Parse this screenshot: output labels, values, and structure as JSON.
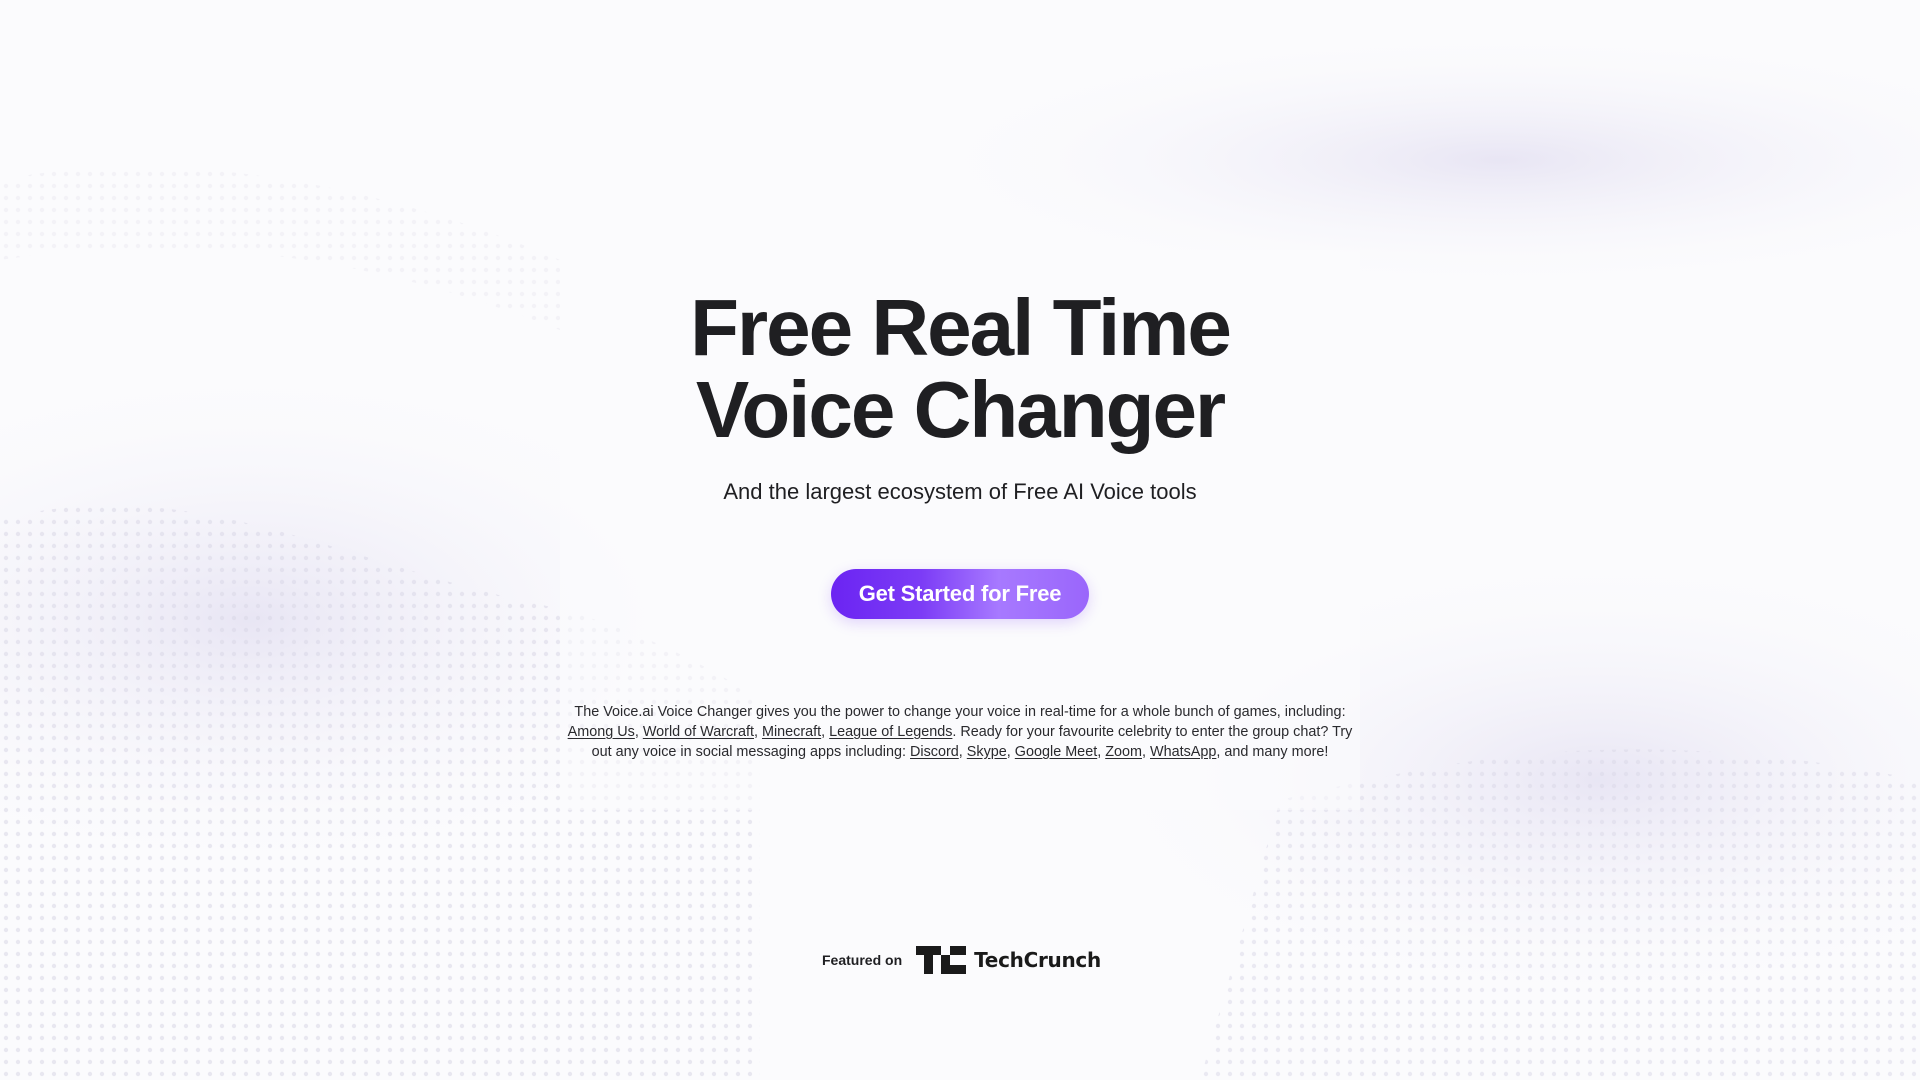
{
  "hero": {
    "headline_line1": "Free Real Time",
    "headline_line2": "Voice Changer",
    "subtitle": "And the largest ecosystem of Free AI Voice tools",
    "cta_label": "Get Started for Free"
  },
  "description": {
    "part1": "The Voice.ai Voice Changer gives you the power to change your voice in real-time for a whole bunch of games, including: ",
    "games": [
      "Among Us",
      "World of Warcraft",
      "Minecraft",
      "League of Legends"
    ],
    "part2": ". Ready for your favourite celebrity to enter the group chat? Try out any voice in social messaging apps including: ",
    "apps": [
      "Discord",
      "Skype",
      "Google Meet",
      "Zoom",
      "WhatsApp"
    ],
    "separator": ", ",
    "part3": ", and many more!"
  },
  "featured": {
    "label": "Featured on",
    "logo_text": "TechCrunch",
    "logo_icon": "techcrunch-tc-icon"
  },
  "colors": {
    "text": "#1f1f22",
    "cta_start": "#6b24f2",
    "cta_end": "#a779ff",
    "background": "#fbfbfd"
  }
}
